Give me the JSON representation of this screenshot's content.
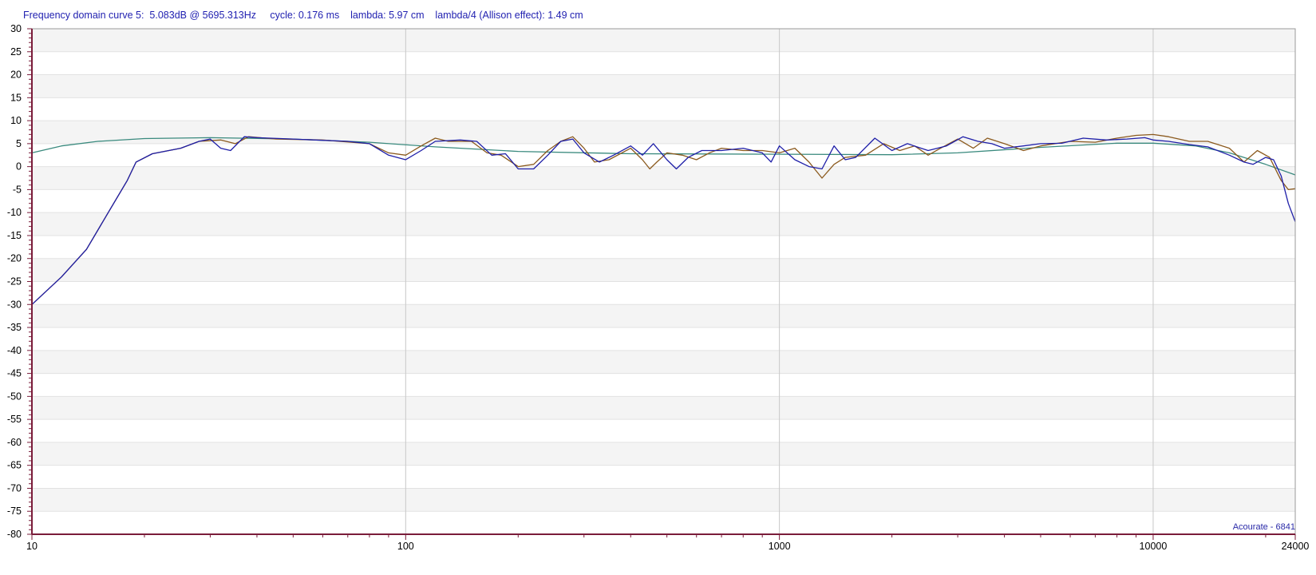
{
  "readout": {
    "text": "Frequency domain curve 5:  5.083dB @ 5695.313Hz     cycle: 0.176 ms    lambda: 5.97 cm    lambda/4 (Allison effect): 1.49 cm"
  },
  "watermark": "Acourate - 6841",
  "colors": {
    "background": "#ffffff",
    "band": "#f4f4f4",
    "grid_major": "#c8c8c8",
    "axis": "#7a1c3a",
    "series_blue": "#1e1ea8",
    "series_brown": "#8b5a1e",
    "series_teal": "#3a8a7e"
  },
  "chart_data": {
    "type": "line",
    "x_scale": "log",
    "xlim": [
      10,
      24000
    ],
    "ylim": [
      -80,
      30
    ],
    "grid": true,
    "x_tick_labels": [
      "10",
      "100",
      "1000",
      "10000",
      "24000"
    ],
    "x_ticks": [
      10,
      100,
      1000,
      10000,
      24000
    ],
    "y_ticks": [
      30,
      25,
      20,
      15,
      10,
      5,
      0,
      -5,
      -10,
      -15,
      -20,
      -25,
      -30,
      -35,
      -40,
      -45,
      -50,
      -55,
      -60,
      -65,
      -70,
      -75,
      -80
    ],
    "series": [
      {
        "color": "#3a8a7e",
        "points": [
          [
            10,
            3
          ],
          [
            12,
            4.5
          ],
          [
            15,
            5.5
          ],
          [
            20,
            6.1
          ],
          [
            30,
            6.3
          ],
          [
            50,
            6
          ],
          [
            80,
            5.3
          ],
          [
            120,
            4.3
          ],
          [
            200,
            3.3
          ],
          [
            400,
            2.8
          ],
          [
            1000,
            2.7
          ],
          [
            2000,
            2.6
          ],
          [
            3000,
            3
          ],
          [
            5000,
            4.2
          ],
          [
            8000,
            5.1
          ],
          [
            10000,
            5.1
          ],
          [
            13000,
            4.5
          ],
          [
            16000,
            3
          ],
          [
            20000,
            0.5
          ],
          [
            24000,
            -1.8
          ]
        ]
      },
      {
        "color": "#8b5a1e",
        "points": [
          [
            10,
            -30
          ],
          [
            12,
            -24
          ],
          [
            14,
            -18
          ],
          [
            16,
            -10
          ],
          [
            18,
            -3
          ],
          [
            19,
            1
          ],
          [
            21,
            2.8
          ],
          [
            25,
            4
          ],
          [
            28,
            5.5
          ],
          [
            32,
            5.8
          ],
          [
            35,
            5
          ],
          [
            38,
            6.5
          ],
          [
            45,
            6
          ],
          [
            60,
            5.8
          ],
          [
            80,
            5
          ],
          [
            90,
            3
          ],
          [
            100,
            2.5
          ],
          [
            110,
            4.5
          ],
          [
            120,
            6.2
          ],
          [
            130,
            5.5
          ],
          [
            150,
            5.5
          ],
          [
            165,
            3
          ],
          [
            180,
            2.5
          ],
          [
            200,
            0
          ],
          [
            220,
            0.5
          ],
          [
            240,
            3.5
          ],
          [
            260,
            5.5
          ],
          [
            280,
            6.5
          ],
          [
            300,
            4
          ],
          [
            320,
            1
          ],
          [
            350,
            1.5
          ],
          [
            400,
            4
          ],
          [
            430,
            1.5
          ],
          [
            450,
            -0.5
          ],
          [
            470,
            1
          ],
          [
            500,
            3
          ],
          [
            550,
            2.5
          ],
          [
            600,
            1.5
          ],
          [
            650,
            3
          ],
          [
            700,
            4
          ],
          [
            800,
            3.5
          ],
          [
            900,
            3.5
          ],
          [
            1000,
            3
          ],
          [
            1100,
            4
          ],
          [
            1200,
            1
          ],
          [
            1300,
            -2.5
          ],
          [
            1400,
            0.5
          ],
          [
            1500,
            2
          ],
          [
            1700,
            2.5
          ],
          [
            1900,
            5
          ],
          [
            2100,
            3.5
          ],
          [
            2300,
            4.5
          ],
          [
            2500,
            2.5
          ],
          [
            2700,
            4
          ],
          [
            3000,
            6
          ],
          [
            3300,
            4
          ],
          [
            3600,
            6.2
          ],
          [
            4000,
            5
          ],
          [
            4500,
            3.5
          ],
          [
            5000,
            4.5
          ],
          [
            6000,
            5.5
          ],
          [
            7000,
            5.3
          ],
          [
            8000,
            6.2
          ],
          [
            9000,
            6.8
          ],
          [
            10000,
            7
          ],
          [
            11000,
            6.5
          ],
          [
            12500,
            5.5
          ],
          [
            14000,
            5.5
          ],
          [
            16000,
            4
          ],
          [
            17500,
            1
          ],
          [
            19000,
            3.5
          ],
          [
            20500,
            2
          ],
          [
            22000,
            -3
          ],
          [
            23000,
            -5
          ],
          [
            24000,
            -4.8
          ]
        ]
      },
      {
        "color": "#1e1ea8",
        "points": [
          [
            10,
            -30
          ],
          [
            12,
            -24
          ],
          [
            14,
            -18
          ],
          [
            16,
            -10
          ],
          [
            18,
            -3
          ],
          [
            19,
            1
          ],
          [
            21,
            2.8
          ],
          [
            25,
            4
          ],
          [
            28,
            5.5
          ],
          [
            30,
            6
          ],
          [
            32,
            4
          ],
          [
            34,
            3.5
          ],
          [
            37,
            6.5
          ],
          [
            40,
            6.3
          ],
          [
            50,
            6
          ],
          [
            70,
            5.5
          ],
          [
            80,
            5
          ],
          [
            90,
            2.5
          ],
          [
            100,
            1.5
          ],
          [
            110,
            3.5
          ],
          [
            120,
            5.5
          ],
          [
            140,
            5.8
          ],
          [
            155,
            5.5
          ],
          [
            170,
            2.5
          ],
          [
            185,
            2.8
          ],
          [
            200,
            -0.5
          ],
          [
            220,
            -0.5
          ],
          [
            240,
            2.5
          ],
          [
            260,
            5.5
          ],
          [
            280,
            6
          ],
          [
            300,
            3
          ],
          [
            330,
            1
          ],
          [
            360,
            2.5
          ],
          [
            400,
            4.5
          ],
          [
            430,
            2.5
          ],
          [
            460,
            5
          ],
          [
            500,
            1.5
          ],
          [
            530,
            -0.5
          ],
          [
            570,
            2
          ],
          [
            620,
            3.5
          ],
          [
            700,
            3.5
          ],
          [
            800,
            4
          ],
          [
            900,
            3
          ],
          [
            950,
            1
          ],
          [
            1000,
            4.5
          ],
          [
            1100,
            1.5
          ],
          [
            1200,
            0
          ],
          [
            1300,
            -0.5
          ],
          [
            1400,
            4.5
          ],
          [
            1500,
            1.5
          ],
          [
            1600,
            2
          ],
          [
            1800,
            6.2
          ],
          [
            2000,
            3.5
          ],
          [
            2200,
            5
          ],
          [
            2500,
            3.5
          ],
          [
            2800,
            4.5
          ],
          [
            3100,
            6.5
          ],
          [
            3400,
            5.5
          ],
          [
            3700,
            5
          ],
          [
            4000,
            4
          ],
          [
            4500,
            4.5
          ],
          [
            5000,
            5
          ],
          [
            5695,
            5.08
          ],
          [
            6500,
            6.2
          ],
          [
            7500,
            5.8
          ],
          [
            8500,
            6
          ],
          [
            9500,
            6.3
          ],
          [
            10000,
            5.8
          ],
          [
            11000,
            5.5
          ],
          [
            12500,
            4.8
          ],
          [
            14000,
            4.3
          ],
          [
            16000,
            2.5
          ],
          [
            17500,
            1
          ],
          [
            18500,
            0.5
          ],
          [
            20000,
            2
          ],
          [
            21000,
            1.5
          ],
          [
            22000,
            -2
          ],
          [
            23000,
            -8
          ],
          [
            24000,
            -12
          ]
        ]
      }
    ]
  }
}
